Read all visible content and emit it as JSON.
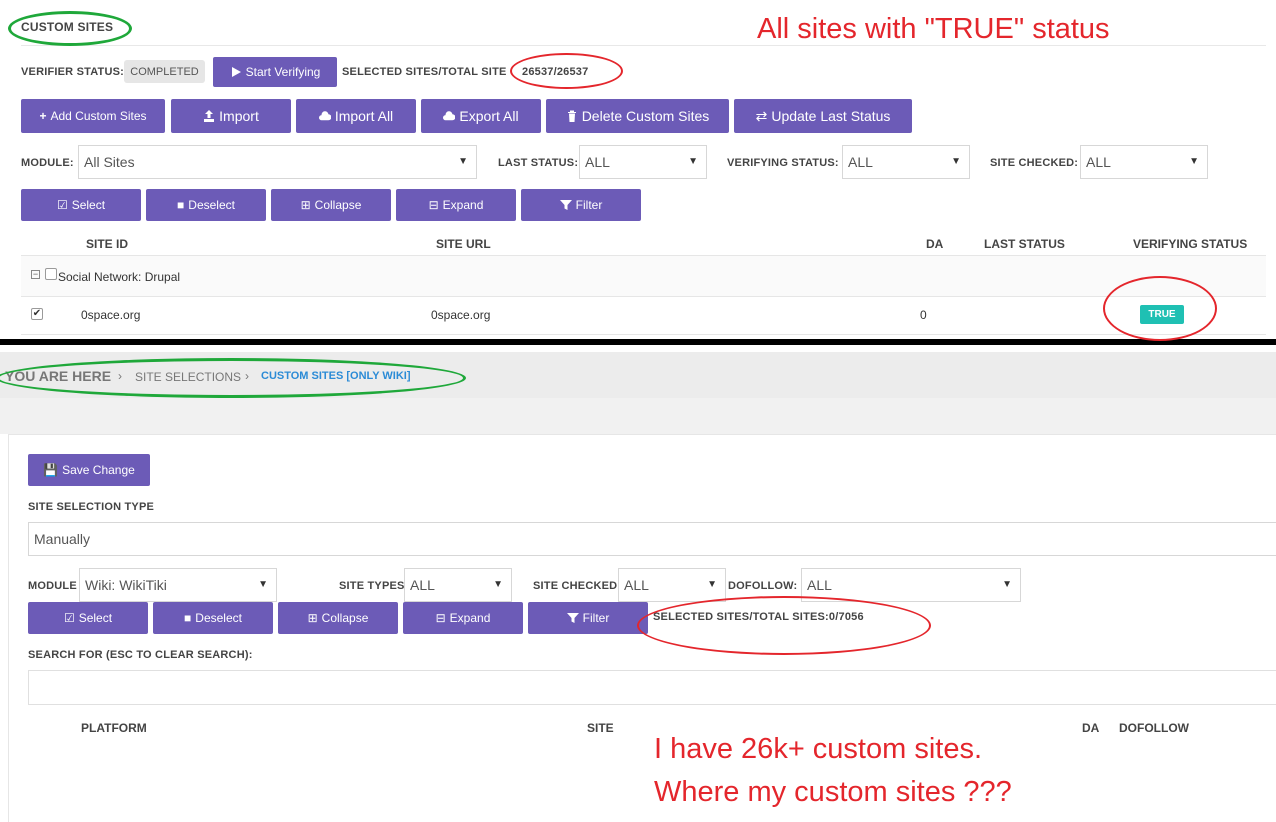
{
  "top": {
    "section_title": "CUSTOM SITES",
    "verifier_status_label": "VERIFIER STATUS:",
    "verifier_status_value": "COMPLETED",
    "start_verifying": "Start Verifying",
    "selected_total_label": "SELECTED SITES/TOTAL SITE",
    "selected_total_value": "26537/26537",
    "buttons": {
      "add_custom_sites": "Add Custom Sites",
      "import": "Import",
      "import_all": "Import All",
      "export_all": "Export All",
      "delete_custom_sites": "Delete Custom Sites",
      "update_last_status": "Update Last Status"
    },
    "filters": {
      "module_label": "MODULE:",
      "module_value": "All Sites",
      "last_status_label": "LAST STATUS:",
      "last_status_value": "ALL",
      "verifying_status_label": "VERIFYING STATUS:",
      "verifying_status_value": "ALL",
      "site_checked_label": "SITE CHECKED:",
      "site_checked_value": "ALL"
    },
    "actions": {
      "select": "Select",
      "deselect": "Deselect",
      "collapse": "Collapse",
      "expand": "Expand",
      "filter": "Filter"
    },
    "table": {
      "headers": [
        "SITE ID",
        "SITE URL",
        "DA",
        "LAST STATUS",
        "VERIFYING STATUS"
      ],
      "group": "Social Network: Drupal",
      "rows": [
        {
          "site_id": "0space.org",
          "site_url": "0space.org",
          "da": "0",
          "last_status": "",
          "verifying_status": "TRUE"
        }
      ]
    }
  },
  "bottom": {
    "breadcrumb": {
      "you_are_here": "YOU ARE HERE",
      "site_selections": "SITE SELECTIONS",
      "current": "CUSTOM SITES [ONLY WIKI]"
    },
    "save_change": "Save Change",
    "site_selection_type_label": "SITE SELECTION TYPE",
    "site_selection_type_value": "Manually",
    "filters": {
      "module_label": "MODULE",
      "module_value": "Wiki: WikiTiki",
      "site_types_label": "SITE TYPES",
      "site_types_value": "ALL",
      "site_checked_label": "SITE CHECKED",
      "site_checked_value": "ALL",
      "dofollow_label": "DOFOLLOW:",
      "dofollow_value": "ALL"
    },
    "actions": {
      "select": "Select",
      "deselect": "Deselect",
      "collapse": "Collapse",
      "expand": "Expand",
      "filter": "Filter"
    },
    "selected_total": "SELECTED SITES/TOTAL SITES:0/7056",
    "search_label": "SEARCH FOR (ESC TO CLEAR SEARCH):",
    "table_headers": [
      "PLATFORM",
      "SITE",
      "DA",
      "DOFOLLOW"
    ]
  },
  "annotations": {
    "top_note": "All sites with \"TRUE\" status",
    "bottom_note_line1": "I have 26k+ custom sites.",
    "bottom_note_line2": "Where my custom sites  ???"
  },
  "colors": {
    "button": "#6c5bb7",
    "true_badge": "#1fc0b3",
    "annotation_red": "#e4262c",
    "annotation_green": "#1fa83a",
    "breadcrumb_active": "#2b8bd6"
  }
}
